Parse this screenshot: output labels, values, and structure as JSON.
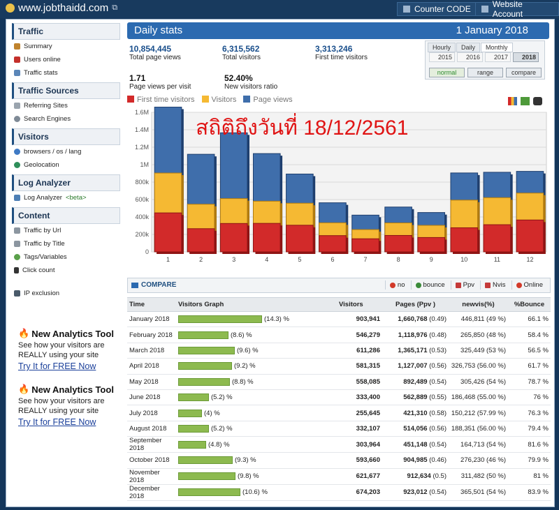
{
  "header": {
    "site": "www.jobthaidd.com",
    "counter_code": "Counter CODE",
    "website_account": "Website Account"
  },
  "sidebar": {
    "sections": [
      {
        "title": "Traffic",
        "items": [
          "Summary",
          "Users online",
          "Traffic stats"
        ]
      },
      {
        "title": "Traffic Sources",
        "items": [
          "Referring Sites",
          "Search Engines"
        ]
      },
      {
        "title": "Visitors",
        "items": [
          "browsers / os / lang",
          "Geolocation"
        ]
      },
      {
        "title": "Log Analyzer",
        "items": [
          "Log Analyzer"
        ],
        "beta": "<beta>"
      },
      {
        "title": "Content",
        "items": [
          "Traffic by Url",
          "Traffic by Title",
          "Tags/Variables",
          "Click count"
        ]
      }
    ],
    "ip_exclusion": "IP exclusion",
    "promos": [
      {
        "title": "New Analytics Tool",
        "line1": "See how your visitors are",
        "line2": "REALLY using your site",
        "link": "Try It for FREE Now"
      },
      {
        "title": "New Analytics Tool",
        "line1": "See how your visitors are",
        "line2": "REALLY using your site",
        "link": "Try It for FREE Now"
      }
    ]
  },
  "main": {
    "title": "Daily stats",
    "date": "1 January 2018",
    "stats": [
      {
        "value": "10,854,445",
        "label": "Total page views"
      },
      {
        "value": "6,315,562",
        "label": "Total visitors"
      },
      {
        "value": "3,313,246",
        "label": "First time visitors"
      },
      {
        "value": "1.71",
        "label": "Page views per visit"
      },
      {
        "value": "52.40%",
        "label": "New visitors ratio"
      }
    ],
    "period_tabs": [
      "Hourly",
      "Daily",
      "Monthly"
    ],
    "years": [
      "2015",
      "2016",
      "2017",
      "2018"
    ],
    "modes": [
      "normal",
      "range",
      "compare"
    ],
    "overlay_text": "สถิติถึงวันที่ 18/12/2561",
    "compare": {
      "label": "COMPARE",
      "buttons": [
        "no",
        "bounce",
        "Ppv",
        "Nvis",
        "Online"
      ]
    }
  },
  "colors": {
    "first_time": "#d22a2a",
    "visitors": "#f5b933",
    "page_views": "#3f6eab",
    "accent": "#2c6ab0",
    "bar_green": "#8dba4f"
  },
  "chart_data": {
    "type": "bar",
    "categories": [
      "1",
      "2",
      "3",
      "4",
      "5",
      "6",
      "7",
      "8",
      "9",
      "10",
      "11",
      "12"
    ],
    "series": [
      {
        "name": "First time visitors",
        "values": [
          446811,
          265850,
          325449,
          326753,
          305426,
          186468,
          150212,
          188351,
          164713,
          276230,
          311482,
          365501
        ]
      },
      {
        "name": "Visitors",
        "values": [
          903941,
          546279,
          611286,
          581315,
          558085,
          333400,
          255645,
          332107,
          303964,
          593660,
          621677,
          674203
        ]
      },
      {
        "name": "Page views",
        "values": [
          1660768,
          1118976,
          1365171,
          1127007,
          892489,
          562889,
          421310,
          514056,
          451148,
          904985,
          912634,
          923012
        ]
      }
    ],
    "yticks": [
      "0",
      "200k",
      "400k",
      "600k",
      "800k",
      "1M",
      "1.2M",
      "1.4M",
      "1.6M"
    ],
    "ylim": [
      0,
      1600000
    ]
  },
  "table": {
    "headers": [
      "Time",
      "Visitors Graph",
      "Visitors",
      "Pages (Ppv )",
      "newvis(%)",
      "%Bounce"
    ],
    "rows": [
      {
        "time": "January 2018",
        "pct": 14.3,
        "pct_label": "(14.3) %",
        "visitors": "903,941",
        "pages": "1,660,768",
        "ppv": "(0.49)",
        "newvis": "446,811 (49 %)",
        "bounce": "66.1 %"
      },
      {
        "time": "February 2018",
        "pct": 8.6,
        "pct_label": "(8.6) %",
        "visitors": "546,279",
        "pages": "1,118,976",
        "ppv": "(0.48)",
        "newvis": "265,850 (48 %)",
        "bounce": "58.4 %"
      },
      {
        "time": "March 2018",
        "pct": 9.6,
        "pct_label": "(9.6) %",
        "visitors": "611,286",
        "pages": "1,365,171",
        "ppv": "(0.53)",
        "newvis": "325,449 (53 %)",
        "bounce": "56.5 %"
      },
      {
        "time": "April 2018",
        "pct": 9.2,
        "pct_label": "(9.2) %",
        "visitors": "581,315",
        "pages": "1,127,007",
        "ppv": "(0.56)",
        "newvis": "326,753 (56.00 %)",
        "bounce": "61.7 %"
      },
      {
        "time": "May 2018",
        "pct": 8.8,
        "pct_label": "(8.8) %",
        "visitors": "558,085",
        "pages": "892,489",
        "ppv": "(0.54)",
        "newvis": "305,426 (54 %)",
        "bounce": "78.7 %"
      },
      {
        "time": "June 2018",
        "pct": 5.2,
        "pct_label": "(5.2) %",
        "visitors": "333,400",
        "pages": "562,889",
        "ppv": "(0.55)",
        "newvis": "186,468 (55.00 %)",
        "bounce": "76 %"
      },
      {
        "time": "July 2018",
        "pct": 4,
        "pct_label": "(4) %",
        "visitors": "255,645",
        "pages": "421,310",
        "ppv": "(0.58)",
        "newvis": "150,212 (57.99 %)",
        "bounce": "76.3 %"
      },
      {
        "time": "August 2018",
        "pct": 5.2,
        "pct_label": "(5.2) %",
        "visitors": "332,107",
        "pages": "514,056",
        "ppv": "(0.56)",
        "newvis": "188,351 (56.00 %)",
        "bounce": "79.4 %"
      },
      {
        "time": "September 2018",
        "pct": 4.8,
        "pct_label": "(4.8) %",
        "visitors": "303,964",
        "pages": "451,148",
        "ppv": "(0.54)",
        "newvis": "164,713 (54 %)",
        "bounce": "81.6 %"
      },
      {
        "time": "October 2018",
        "pct": 9.3,
        "pct_label": "(9.3) %",
        "visitors": "593,660",
        "pages": "904,985",
        "ppv": "(0.46)",
        "newvis": "276,230 (46 %)",
        "bounce": "79.9 %"
      },
      {
        "time": "November 2018",
        "pct": 9.8,
        "pct_label": "(9.8) %",
        "visitors": "621,677",
        "pages": "912,634",
        "ppv": "(0.5)",
        "newvis": "311,482 (50 %)",
        "bounce": "81 %"
      },
      {
        "time": "December 2018",
        "pct": 10.6,
        "pct_label": "(10.6) %",
        "visitors": "674,203",
        "pages": "923,012",
        "ppv": "(0.54)",
        "newvis": "365,501 (54 %)",
        "bounce": "83.9 %"
      }
    ]
  }
}
